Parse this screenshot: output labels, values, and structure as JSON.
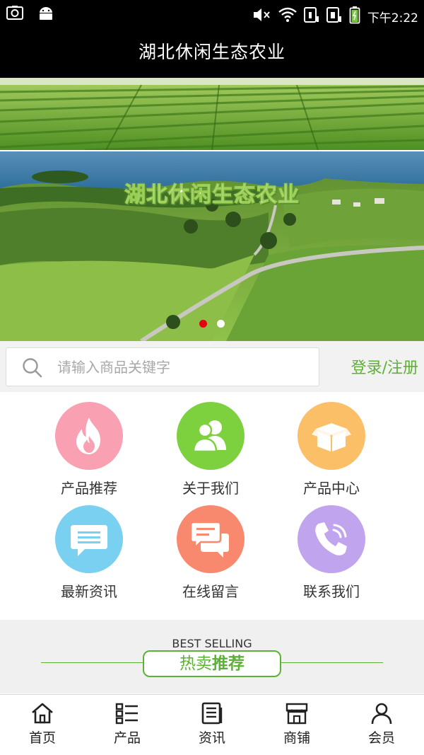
{
  "status_bar": {
    "time": "下午2:22",
    "icons": [
      "screenshot-icon",
      "android-icon",
      "mute-icon",
      "wifi-icon",
      "sim1-icon",
      "sim2-icon",
      "battery-icon"
    ]
  },
  "header": {
    "title": "湖北休闲生态农业"
  },
  "banner": {
    "overlay_text": "湖北休闲生态农业",
    "slide_count": 2,
    "active_slide": 1
  },
  "search": {
    "placeholder": "请输入商品关键字",
    "login_label": "登录/注册"
  },
  "menu": [
    {
      "label": "产品推荐",
      "icon": "fire-icon",
      "color": "#f9a1b3"
    },
    {
      "label": "关于我们",
      "icon": "users-icon",
      "color": "#7ed13e"
    },
    {
      "label": "产品中心",
      "icon": "box-icon",
      "color": "#fbbf68"
    },
    {
      "label": "最新资讯",
      "icon": "news-icon",
      "color": "#7ad0f0"
    },
    {
      "label": "在线留言",
      "icon": "chat-icon",
      "color": "#f9896e"
    },
    {
      "label": "联系我们",
      "icon": "phone-icon",
      "color": "#c0a5ee"
    }
  ],
  "best_selling": {
    "english": "BEST SELLING",
    "chinese_left": "热卖",
    "chinese_right": "推荐",
    "accent": "#5cb234"
  },
  "tabbar": [
    {
      "label": "首页",
      "icon": "home-icon"
    },
    {
      "label": "产品",
      "icon": "list-icon"
    },
    {
      "label": "资讯",
      "icon": "document-icon"
    },
    {
      "label": "商铺",
      "icon": "store-icon"
    },
    {
      "label": "会员",
      "icon": "user-icon"
    }
  ]
}
